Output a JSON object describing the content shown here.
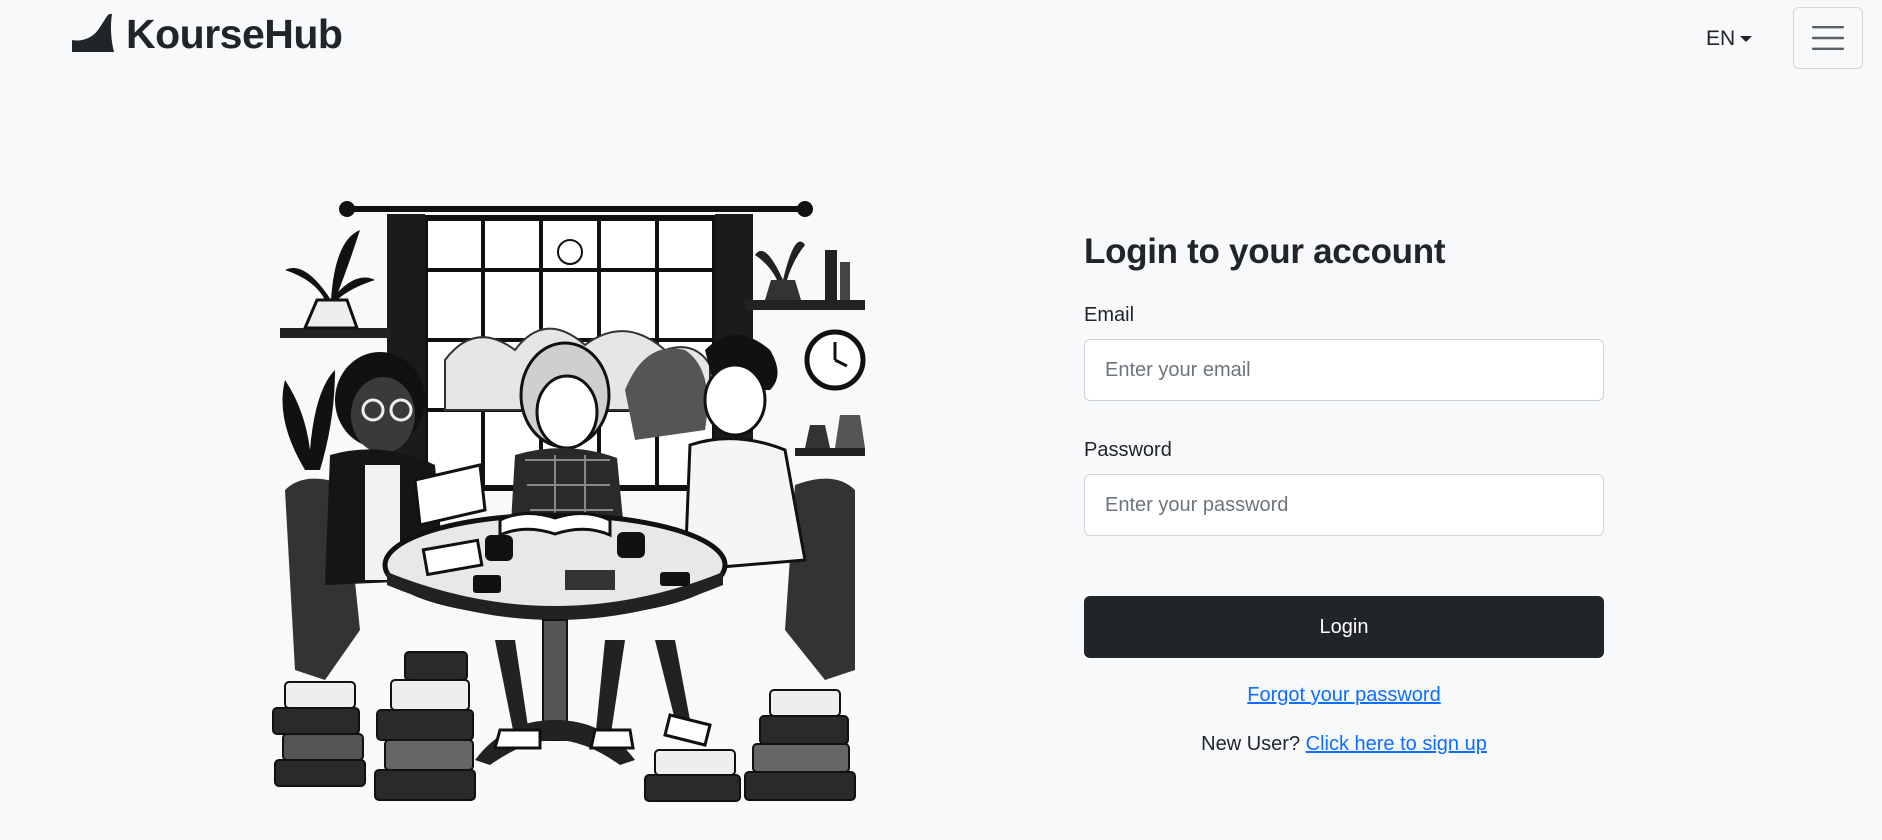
{
  "brand": {
    "name": "KourseHub",
    "logo_icon": "shark-fin-logo"
  },
  "nav": {
    "language": "EN",
    "menu_icon": "hamburger-menu-icon"
  },
  "illustration": {
    "description_icon": "students-studying-illustration"
  },
  "login": {
    "title": "Login to your account",
    "email_label": "Email",
    "email_placeholder": "Enter your email",
    "email_value": "",
    "password_label": "Password",
    "password_placeholder": "Enter your password",
    "password_value": "",
    "submit_label": "Login",
    "forgot_link": "Forgot your password",
    "new_user_text": "New User?",
    "signup_link": "Click here to sign up"
  },
  "colors": {
    "primary_dark": "#212529",
    "link": "#0d6efd",
    "background": "#f8f9fa"
  }
}
